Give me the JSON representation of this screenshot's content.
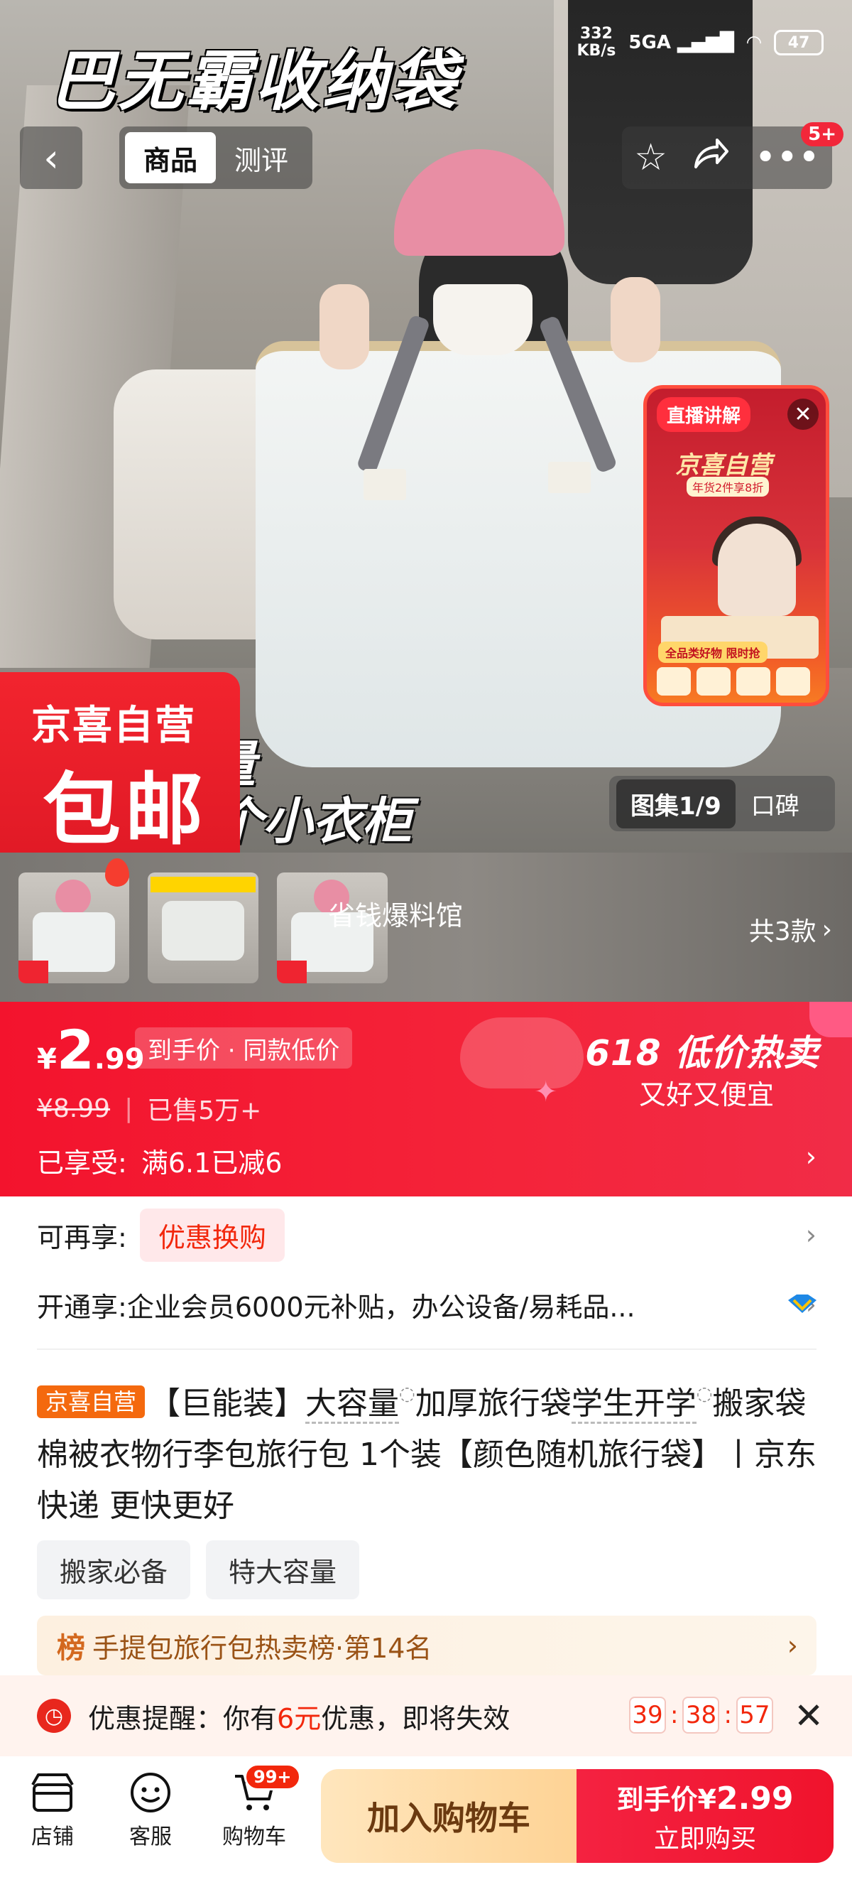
{
  "hero": {
    "headline": "巴无霸收纳袋",
    "caption_1": "量",
    "caption_2": "个小衣柜"
  },
  "status_bar": {
    "net_speed": "332",
    "net_unit": "KB/s",
    "network": "5GA",
    "battery": "47"
  },
  "nav": {
    "back_icon": "chevron-left-icon",
    "tabs": [
      {
        "label": "商品",
        "active": true
      },
      {
        "label": "测评",
        "active": false
      }
    ],
    "actions": [
      "star-icon",
      "share-icon",
      "more-icon"
    ],
    "more_badge": "5+"
  },
  "live": {
    "label": "直播讲解",
    "title": "京喜自营",
    "subtitle": "年货2件享8折",
    "promo_line": "全品类好物 限时抢"
  },
  "badge": {
    "line1": "京喜自营",
    "line2": "包邮"
  },
  "gallery": {
    "active": "图集1/9",
    "other": "口碑"
  },
  "thumbnails": {
    "shop_name": "省钱爆料馆",
    "variants_label": "共3款"
  },
  "price": {
    "currency": "¥",
    "integer": "2",
    "decimal": ".99",
    "tag": "到手价 · 同款低价",
    "original": "¥8.99",
    "sold": "已售5万+",
    "promo_title": "618 低价热卖",
    "promo_sub": "又好又便宜",
    "enjoyed_label": "已享受:",
    "enjoyed_value": "满6.1已减6",
    "colors": {
      "banner": "#f3132d"
    }
  },
  "offers": {
    "more_label": "可再享:",
    "coupon": "优惠换购",
    "member_label": "开通享:",
    "member_text": "企业会员6000元补贴，办公设备/易耗品..."
  },
  "title": {
    "tag": "京喜自营",
    "part1": "【巨能装】",
    "kw1": "大容量",
    "part2": "加厚旅行袋",
    "kw2": "学生开学",
    "part3": "搬家袋棉被衣物行李包旅行包 1个装【颜色随机旅行袋】丨京东快递 更快更好"
  },
  "chips": [
    "搬家必备",
    "特大容量"
  ],
  "rank": {
    "icon": "榜",
    "text": "手提包旅行包热卖榜·第14名"
  },
  "reminder": {
    "label": "优惠提醒：你有",
    "amount": "6元",
    "suffix": "优惠，即将失效",
    "timer": [
      "39",
      "38",
      "57"
    ]
  },
  "bottom": {
    "store": "店铺",
    "service": "客服",
    "cart": "购物车",
    "cart_badge": "99+",
    "add_cart": "加入购物车",
    "buy_top_prefix": "到手价",
    "buy_currency": "¥",
    "buy_price": "2.99",
    "buy_bottom": "立即购买"
  }
}
